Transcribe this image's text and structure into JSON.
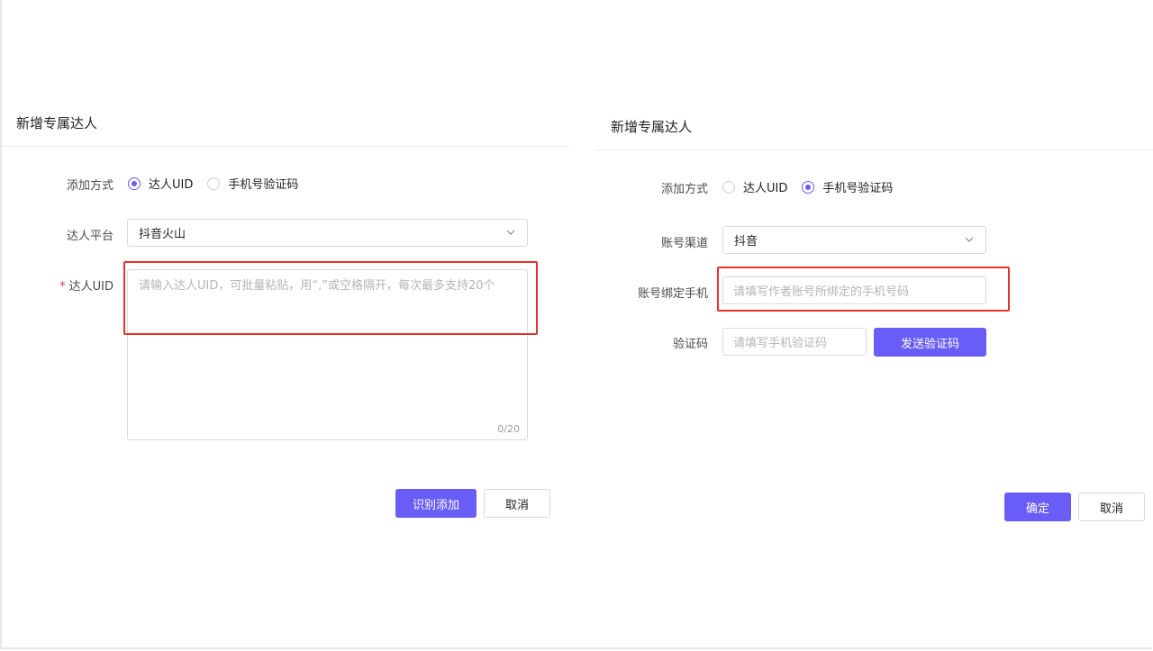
{
  "left_dialog": {
    "title": "新增专属达人",
    "add_method_label": "添加方式",
    "add_method_options": [
      "达人UID",
      "手机号验证码"
    ],
    "add_method_selected": "达人UID",
    "platform_label": "达人平台",
    "platform_value": "抖音火山",
    "uid_required_mark": "*",
    "uid_label": "达人UID",
    "uid_placeholder": "请输入达人UID，可批量粘贴，用“,”或空格隔开，每次最多支持20个",
    "uid_counter": "0/20",
    "submit_label": "识别添加",
    "cancel_label": "取消"
  },
  "right_dialog": {
    "title": "新增专属达人",
    "add_method_label": "添加方式",
    "add_method_options": [
      "达人UID",
      "手机号验证码"
    ],
    "add_method_selected": "手机号验证码",
    "channel_label": "账号渠道",
    "channel_value": "抖音",
    "phone_label": "账号绑定手机",
    "phone_placeholder": "请填写作者账号所绑定的手机号码",
    "code_label": "验证码",
    "code_placeholder": "请填写手机验证码",
    "send_code_label": "发送验证码",
    "confirm_label": "确定",
    "cancel_label": "取消"
  },
  "colors": {
    "accent": "#6a5cf6",
    "highlight": "#e5322d",
    "required": "#e23c39"
  },
  "icons": {
    "select_arrow": "chevron-down-icon"
  }
}
